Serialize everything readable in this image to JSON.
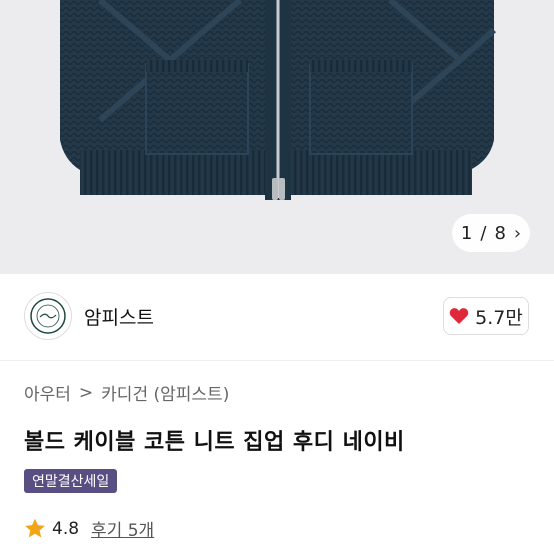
{
  "gallery": {
    "current": "1",
    "total": "8",
    "separator": "/",
    "next_icon": "chevron-right-icon"
  },
  "brand": {
    "name": "암피스트",
    "like_count": "5.7만",
    "like_icon": "heart-icon",
    "like_color": "#e0283b"
  },
  "breadcrumb": {
    "items": [
      "아우터",
      "카디건 (암피스트)"
    ],
    "separator": ">"
  },
  "product": {
    "title": "볼드 케이블 코튼 니트 집업 후디 네이비",
    "badge": "연말결산세일",
    "badge_color": "#5a4f82"
  },
  "rating": {
    "score": "4.8",
    "review_label": "후기 5개",
    "star_color": "#f2a516"
  }
}
